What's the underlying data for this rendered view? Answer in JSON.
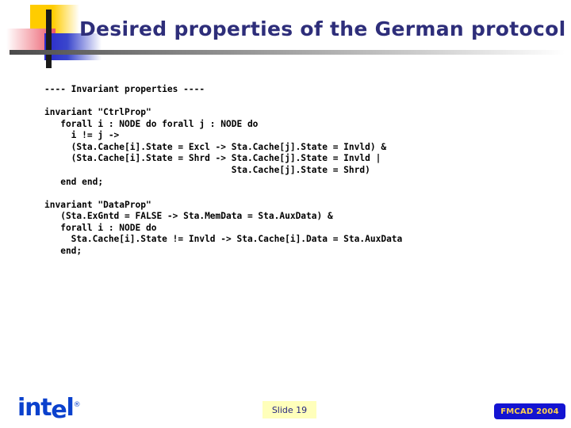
{
  "slide": {
    "title": "Desired properties of the German protocol",
    "logo_mark": {
      "yellow": "#FFCC00",
      "red": "#E8536A",
      "blue": "#2A2ACC",
      "cross": "#1A1A1A"
    },
    "title_color": "#2E2E7A",
    "divider_color": "#4A4A4A"
  },
  "code": {
    "lines": [
      "---- Invariant properties ----",
      "",
      "invariant \"CtrlProp\"",
      "   forall i : NODE do forall j : NODE do",
      "     i != j ->",
      "     (Sta.Cache[i].State = Excl -> Sta.Cache[j].State = Invld) &",
      "     (Sta.Cache[i].State = Shrd -> Sta.Cache[j].State = Invld |",
      "                                   Sta.Cache[j].State = Shrd)",
      "   end end;",
      "",
      "invariant \"DataProp\"",
      "   (Sta.ExGntd = FALSE -> Sta.MemData = Sta.AuxData) &",
      "   forall i : NODE do",
      "     Sta.Cache[i].State != Invld -> Sta.Cache[i].Data = Sta.AuxData",
      "   end;"
    ],
    "text": "---- Invariant properties ----\n\ninvariant \"CtrlProp\"\n   forall i : NODE do forall j : NODE do\n     i != j ->\n     (Sta.Cache[i].State = Excl -> Sta.Cache[j].State = Invld) &\n     (Sta.Cache[i].State = Shrd -> Sta.Cache[j].State = Invld |\n                                   Sta.Cache[j].State = Shrd)\n   end end;\n\ninvariant \"DataProp\"\n   (Sta.ExGntd = FALSE -> Sta.MemData = Sta.AuxData) &\n   forall i : NODE do\n     Sta.Cache[i].State != Invld -> Sta.Cache[i].Data = Sta.AuxData\n   end;"
  },
  "footer": {
    "brand": {
      "part1": "int",
      "part_e": "e",
      "part2": "l",
      "registered": "®",
      "color": "#0B41CD"
    },
    "slide_number": "Slide 19",
    "slide_number_bg": "#FFFFBB",
    "slide_number_color": "#26267F",
    "conference": "FMCAD 2004",
    "conference_bg": "#1414D2",
    "conference_color": "#FFD24D"
  }
}
